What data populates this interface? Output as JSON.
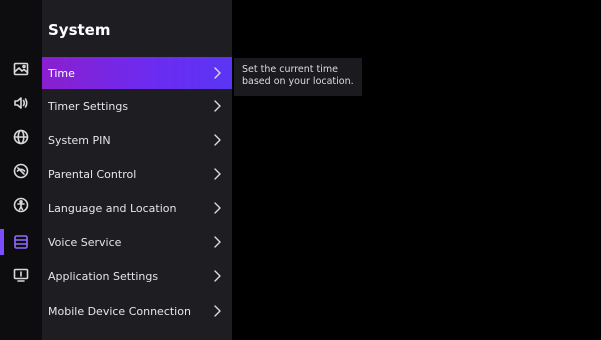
{
  "panel": {
    "title": "System",
    "items": [
      {
        "label": "Time"
      },
      {
        "label": "Timer Settings"
      },
      {
        "label": "System PIN"
      },
      {
        "label": "Parental Control"
      },
      {
        "label": "Language and Location"
      },
      {
        "label": "Voice Service"
      },
      {
        "label": "Application Settings"
      },
      {
        "label": "Mobile Device Connection"
      }
    ]
  },
  "tooltip": {
    "line1": "Set the current time",
    "line2": "based on your location."
  },
  "rail": {
    "icons": [
      "picture-icon",
      "sound-icon",
      "network-icon",
      "channel-icon",
      "accessibility-icon",
      "system-icon",
      "support-icon"
    ]
  },
  "colors": {
    "accent": "#7b4dff",
    "selected_start": "#8a1fcf",
    "selected_end": "#5a35f4",
    "panel_bg": "#1d1d22"
  }
}
